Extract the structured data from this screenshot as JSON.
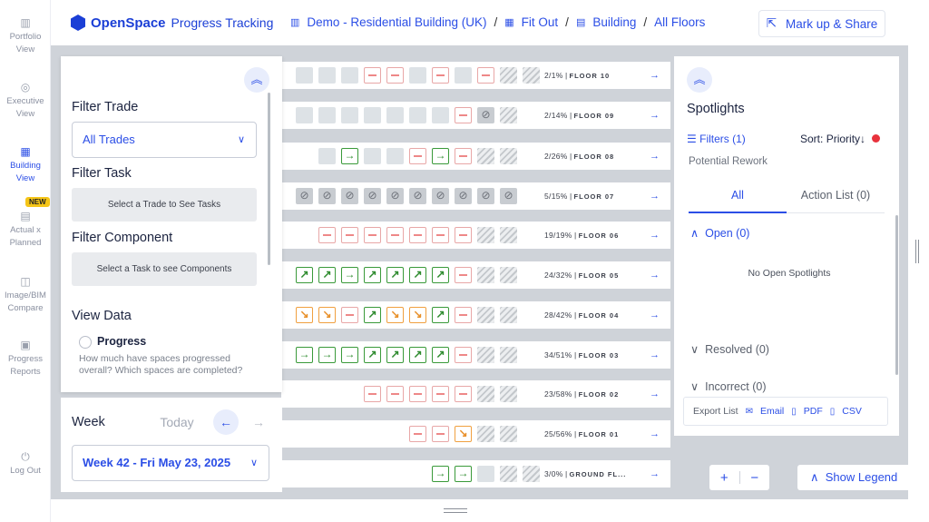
{
  "nav": {
    "items": [
      {
        "label1": "Portfolio",
        "label2": "View",
        "icon": "map-icon"
      },
      {
        "label1": "Executive",
        "label2": "View",
        "icon": "target-icon"
      },
      {
        "label1": "Building",
        "label2": "View",
        "icon": "building-icon"
      },
      {
        "label1": "Actual x",
        "label2": "Planned",
        "icon": "calendar-icon"
      },
      {
        "label1": "Image/BIM",
        "label2": "Compare",
        "icon": "compare-icon"
      },
      {
        "label1": "Progress",
        "label2": "Reports",
        "icon": "report-icon"
      },
      {
        "label1": "Log Out",
        "label2": "",
        "icon": "logout-icon"
      }
    ],
    "new_badge": "NEW"
  },
  "header": {
    "brand": "OpenSpace",
    "product": "Progress Tracking",
    "breadcrumb": [
      "Demo - Residential Building (UK)",
      "Fit Out",
      "Building",
      "All Floors"
    ],
    "share_button": "Mark up & Share"
  },
  "filters": {
    "trade_title": "Filter Trade",
    "trade_value": "All Trades",
    "task_title": "Filter Task",
    "task_placeholder": "Select a Trade to See Tasks",
    "component_title": "Filter Component",
    "component_placeholder": "Select a Task to see Components",
    "view_data_title": "View Data",
    "progress_label": "Progress",
    "progress_desc": "How much have spaces progressed overall? Which spaces are completed?"
  },
  "week": {
    "label": "Week",
    "today": "Today",
    "selected": "Week 42 - Fri May 23, 2025"
  },
  "floors": [
    {
      "pct": "2/1%",
      "name": "FLOOR 10"
    },
    {
      "pct": "2/14%",
      "name": "FLOOR 09"
    },
    {
      "pct": "2/26%",
      "name": "FLOOR 08"
    },
    {
      "pct": "5/15%",
      "name": "FLOOR 07"
    },
    {
      "pct": "19/19%",
      "name": "FLOOR 06"
    },
    {
      "pct": "24/32%",
      "name": "FLOOR 05"
    },
    {
      "pct": "28/42%",
      "name": "FLOOR 04"
    },
    {
      "pct": "34/51%",
      "name": "FLOOR 03"
    },
    {
      "pct": "23/58%",
      "name": "FLOOR 02"
    },
    {
      "pct": "25/56%",
      "name": "FLOOR 01"
    },
    {
      "pct": "3/0%",
      "name": "GROUND FL..."
    }
  ],
  "spotlights": {
    "title": "Spotlights",
    "filters": "Filters (1)",
    "sort_label": "Sort:",
    "sort_value": "Priority",
    "subtitle": "Potential Rework",
    "tab_all": "All",
    "tab_action": "Action List (0)",
    "open": "Open (0)",
    "no_open": "No Open Spotlights",
    "resolved": "Resolved (0)",
    "incorrect": "Incorrect (0)",
    "export_label": "Export List",
    "export_email": "Email",
    "export_pdf": "PDF",
    "export_csv": "CSV"
  },
  "map_controls": {
    "zoom_in": "+",
    "zoom_out": "−",
    "legend": "Show Legend"
  },
  "colors": {
    "accent": "#2b4ee6",
    "complete": "#3a9a3a",
    "in_progress": "#f0a040",
    "not_started": "#e88888"
  }
}
